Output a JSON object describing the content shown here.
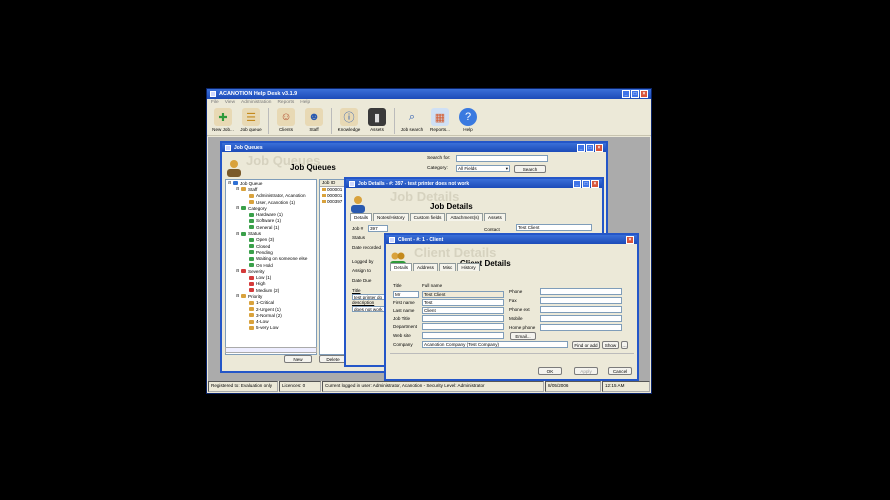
{
  "app": {
    "title": "ACANOTION Help Desk v3.1.9",
    "menu": [
      "File",
      "View",
      "Administration",
      "Reports",
      "Help"
    ],
    "toolbar": [
      {
        "label": "New Job...",
        "icon": "new-job-icon"
      },
      {
        "label": "Job queue",
        "icon": "job-queue-icon"
      },
      {
        "label": "Clients",
        "icon": "clients-icon"
      },
      {
        "label": "Staff",
        "icon": "staff-icon"
      },
      {
        "label": "Knowledge",
        "icon": "knowledge-icon"
      },
      {
        "label": "Assets",
        "icon": "assets-icon"
      },
      {
        "label": "Job search",
        "icon": "magnifier-icon"
      },
      {
        "label": "Reports...",
        "icon": "reports-icon"
      },
      {
        "label": "Help",
        "icon": "help-icon"
      }
    ],
    "status": {
      "registered": "Registered to: Evaluation only",
      "licences": "Licences: 0",
      "user": "Current logged in user: Administrator, Acanotion - Security Level: Administrator",
      "date": "8/05/2006",
      "time": "12:15 AM"
    }
  },
  "job_queues": {
    "window_title": "Job Queues",
    "ghost": "Job Queues",
    "heading": "Job Queues",
    "search_label": "Search for:",
    "search_value": "",
    "category_label": "Category:",
    "category_value": "All Fields",
    "search_button": "Search",
    "tree": [
      {
        "text": "Job Queue",
        "level": 0,
        "color": "#2e6fd4"
      },
      {
        "text": "Staff",
        "level": 1,
        "color": "#d9a23c"
      },
      {
        "text": "Administrator, Acanotion",
        "level": 2,
        "color": "#d9a23c"
      },
      {
        "text": "User, Acanotion (1)",
        "level": 2,
        "color": "#d9a23c"
      },
      {
        "text": "Category",
        "level": 1,
        "color": "#3aa04a"
      },
      {
        "text": "Hardware (1)",
        "level": 2,
        "color": "#3aa04a"
      },
      {
        "text": "Software (1)",
        "level": 2,
        "color": "#3aa04a"
      },
      {
        "text": "General (1)",
        "level": 2,
        "color": "#3aa04a"
      },
      {
        "text": "Status",
        "level": 1,
        "color": "#3aa04a"
      },
      {
        "text": "Open (3)",
        "level": 2,
        "color": "#3aa04a"
      },
      {
        "text": "Closed",
        "level": 2,
        "color": "#3aa04a"
      },
      {
        "text": "Pending",
        "level": 2,
        "color": "#3aa04a"
      },
      {
        "text": "Waiting on someone else",
        "level": 2,
        "color": "#3aa04a"
      },
      {
        "text": "On Hold",
        "level": 2,
        "color": "#3aa04a"
      },
      {
        "text": "Severity",
        "level": 1,
        "color": "#d43a3a"
      },
      {
        "text": "Low (1)",
        "level": 2,
        "color": "#d43a3a"
      },
      {
        "text": "High",
        "level": 2,
        "color": "#d43a3a"
      },
      {
        "text": "Medium (2)",
        "level": 2,
        "color": "#d43a3a"
      },
      {
        "text": "Priority",
        "level": 1,
        "color": "#d9a23c"
      },
      {
        "text": "1-Critical",
        "level": 2,
        "color": "#d9a23c"
      },
      {
        "text": "2-Urgent (1)",
        "level": 2,
        "color": "#d9a23c"
      },
      {
        "text": "3-Normal (2)",
        "level": 2,
        "color": "#d9a23c"
      },
      {
        "text": "4-Low",
        "level": 2,
        "color": "#d9a23c"
      },
      {
        "text": "5-very Low",
        "level": 2,
        "color": "#d9a23c"
      }
    ],
    "list_header": "Job ID",
    "list_rows": [
      "000001",
      "000001",
      "000397"
    ],
    "new_button": "New",
    "delete_button": "Delete",
    "add_new_job": "Add New Job A"
  },
  "job_details": {
    "window_title": "Job Details - #: 397 - test printer does not work",
    "ghost": "Job Details",
    "heading": "Job Details",
    "tabs": [
      "Details",
      "Notes/History",
      "Custom fields",
      "Attachment(s)",
      "Assets"
    ],
    "job_label": "Job #",
    "job_value": "397",
    "status_label": "Status",
    "date_recorded_label": "Date recorded",
    "logged_by_label": "Logged by",
    "assign_to_label": "Assign to",
    "date_due_label": "Date Due",
    "title_label": "Title",
    "title_value": "test printer do",
    "description_label": "description",
    "description_value": "does not work",
    "contact_label": "Contact",
    "contact_value": "Test Client"
  },
  "client_details": {
    "window_title": "Client - #: 1 - Client",
    "ghost": "Client Details",
    "heading": "Client Details",
    "tabs": [
      "Details",
      "Address",
      "Misc",
      "History"
    ],
    "fields_left": [
      {
        "label": "Title",
        "value": "Mr"
      },
      {
        "label": "First name",
        "value": "Test"
      },
      {
        "label": "Last name",
        "value": "Client"
      },
      {
        "label": "Job Title",
        "value": ""
      },
      {
        "label": "Department",
        "value": ""
      },
      {
        "label": "Web site",
        "value": ""
      },
      {
        "label": "Company",
        "value": "Acanotion Company (Test Company)"
      }
    ],
    "full_name_label": "Full name",
    "full_name_value": "Test Client",
    "fields_right": [
      {
        "label": "Phone",
        "value": ""
      },
      {
        "label": "Fax",
        "value": ""
      },
      {
        "label": "Phone ext",
        "value": ""
      },
      {
        "label": "Mobile",
        "value": ""
      },
      {
        "label": "Home phone",
        "value": ""
      }
    ],
    "email_button": "Email...",
    "find_button": "Find or add",
    "show_button": "Show",
    "ok_button": "OK",
    "apply_button": "Apply",
    "cancel_button": "Cancel"
  }
}
